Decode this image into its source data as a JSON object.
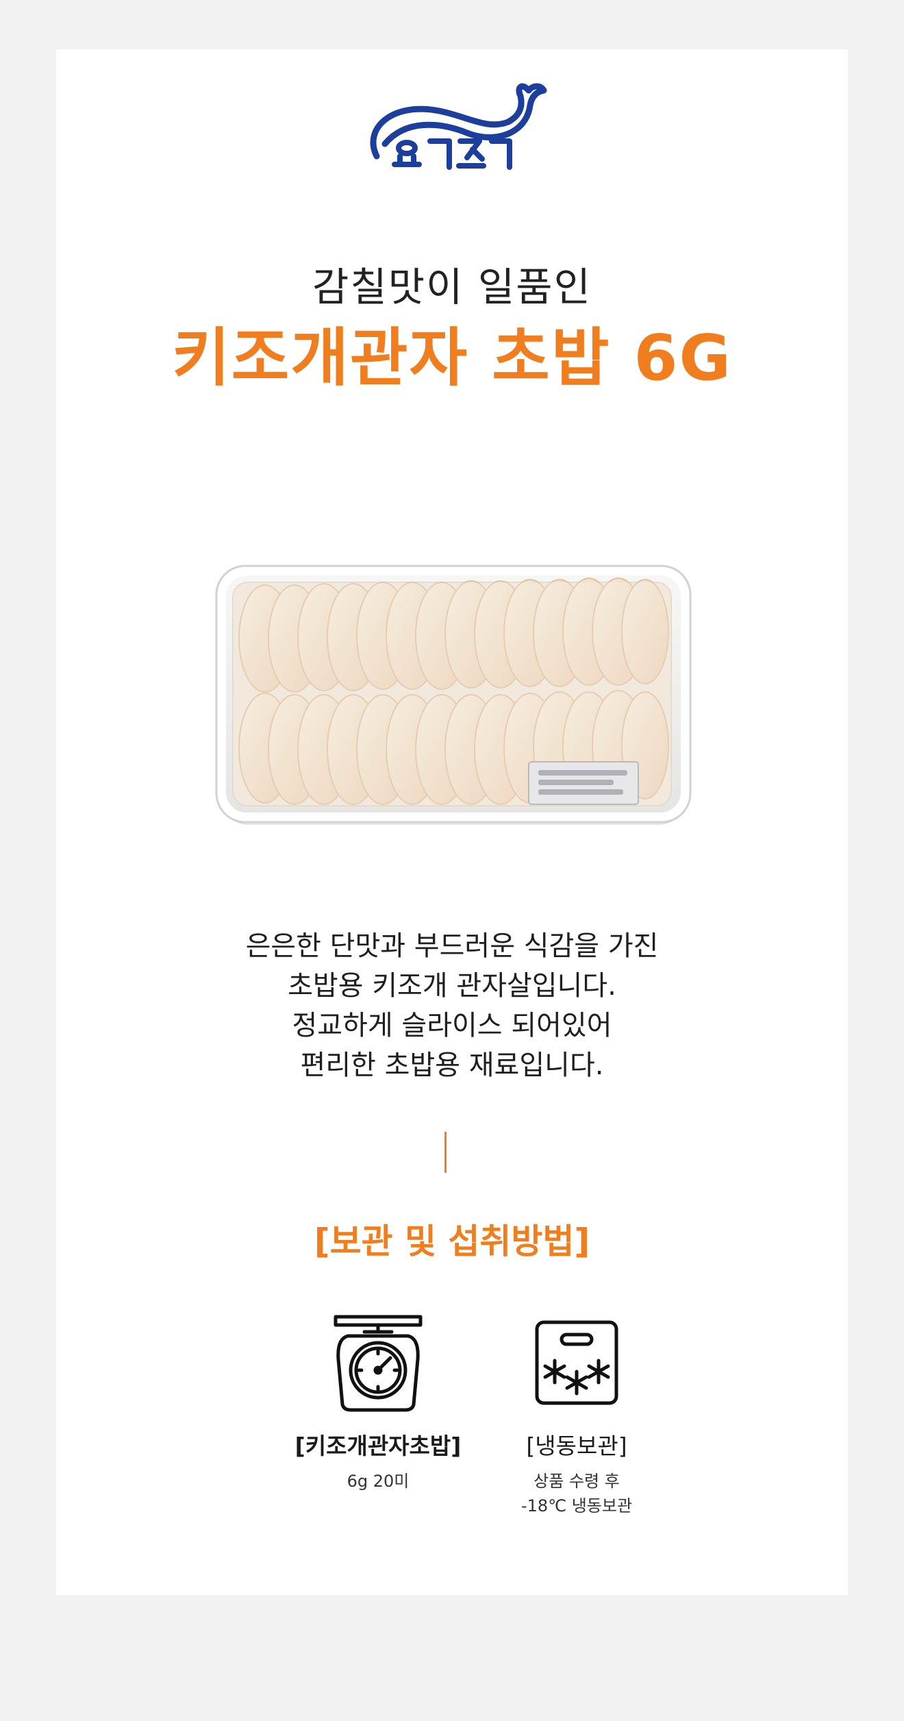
{
  "brand": {
    "logo_text": "요기조기",
    "logo_color": "#1c3e9c"
  },
  "hero": {
    "subtitle": "감칠맛이 일품인",
    "title": "키조개관자 초밥 6G",
    "accent_color": "#f07d1e"
  },
  "product_image": {
    "label_blurred": true
  },
  "description": {
    "lines": [
      "은은한 단맛과 부드러운 식감을 가진",
      "초밥용 키조개 관자살입니다.",
      "정교하게 슬라이스 되어있어",
      "편리한 초밥용 재료입니다."
    ]
  },
  "storage": {
    "heading": "[보관 및 섭취방법]",
    "items": [
      {
        "icon": "scale-icon",
        "label": "[키조개관자초밥]",
        "detail_lines": [
          "6g 20미"
        ]
      },
      {
        "icon": "freezer-icon",
        "label": "[냉동보관]",
        "detail_lines": [
          "상품 수령 후",
          "-18℃ 냉동보관"
        ]
      }
    ]
  }
}
